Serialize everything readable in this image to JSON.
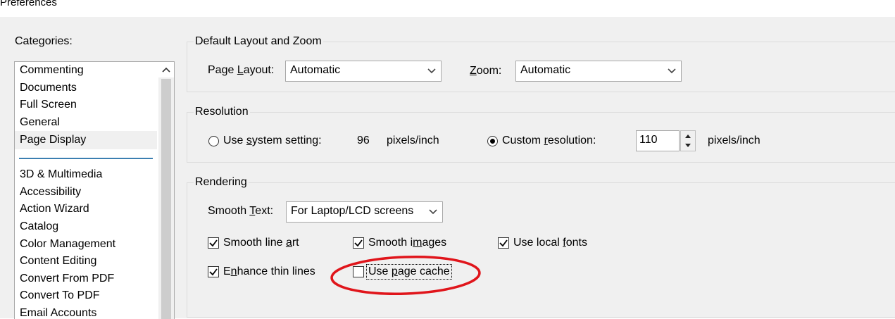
{
  "window": {
    "title": "Preferences"
  },
  "categories": {
    "label": "Categories:",
    "items": [
      {
        "label": "Commenting"
      },
      {
        "label": "Documents"
      },
      {
        "label": "Full Screen"
      },
      {
        "label": "General"
      },
      {
        "label": "Page Display",
        "selected": true
      },
      {
        "label": "3D & Multimedia"
      },
      {
        "label": "Accessibility"
      },
      {
        "label": "Action Wizard"
      },
      {
        "label": "Catalog"
      },
      {
        "label": "Color Management"
      },
      {
        "label": "Content Editing"
      },
      {
        "label": "Convert From PDF"
      },
      {
        "label": "Convert To PDF"
      },
      {
        "label": "Email Accounts"
      }
    ]
  },
  "layout_zoom": {
    "title": "Default Layout and Zoom",
    "page_layout_label": "Page Layout:",
    "page_layout_value": "Automatic",
    "zoom_label": "Zoom:",
    "zoom_value": "Automatic"
  },
  "resolution": {
    "title": "Resolution",
    "system_label": "Use system setting:",
    "system_value": "96",
    "system_unit": "pixels/inch",
    "system_selected": false,
    "custom_label": "Custom resolution:",
    "custom_selected": true,
    "custom_value": "110",
    "custom_unit": "pixels/inch"
  },
  "rendering": {
    "title": "Rendering",
    "smooth_text_label": "Smooth Text:",
    "smooth_text_value": "For Laptop/LCD screens",
    "options": {
      "smooth_line_art": {
        "label": "Smooth line art",
        "checked": true
      },
      "smooth_images": {
        "label": "Smooth images",
        "checked": true
      },
      "use_local_fonts": {
        "label": "Use local fonts",
        "checked": true
      },
      "enhance_thin_lines": {
        "label": "Enhance thin lines",
        "checked": true
      },
      "use_page_cache": {
        "label": "Use page cache",
        "checked": false
      }
    }
  },
  "annotation": {
    "color": "#e0151b"
  }
}
